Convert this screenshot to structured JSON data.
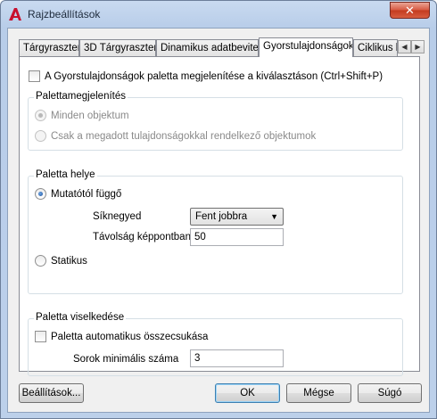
{
  "window": {
    "title": "Rajzbeállítások",
    "close_glyph": "✕",
    "app_icon": "autocad-a-icon"
  },
  "tabs": [
    {
      "label": "Tárgyraszter"
    },
    {
      "label": "3D Tárgyraszter"
    },
    {
      "label": "Dinamikus adatbevitel"
    },
    {
      "label": "Gyorstulajdonságok"
    },
    {
      "label": "Ciklikus k"
    }
  ],
  "active_tab": "Gyorstulajdonságok",
  "tab_scroll": {
    "left": "◀",
    "right": "▶"
  },
  "show_palette_checkbox": {
    "label": "A Gyorstulajdonságok paletta megjelenítése a kiválasztáson (Ctrl+Shift+P)",
    "checked": false
  },
  "palette_display": {
    "title": "Palettamegjelenítés",
    "options": [
      {
        "label": "Minden objektum",
        "selected": true,
        "enabled": false
      },
      {
        "label": "Csak a megadott tulajdonságokkal rendelkező objektumok",
        "selected": false,
        "enabled": false
      }
    ]
  },
  "palette_location": {
    "title": "Paletta helye",
    "cursor_option": {
      "label": "Mutatótól függő",
      "selected": true
    },
    "quadrant": {
      "label": "Síknegyed",
      "value": "Fent jobbra"
    },
    "distance": {
      "label": "Távolság képpontban",
      "value": "50"
    },
    "static_option": {
      "label": "Statikus",
      "selected": false
    }
  },
  "palette_behavior": {
    "title": "Paletta viselkedése",
    "autocollapse": {
      "label": "Paletta automatikus összecsukása",
      "checked": false
    },
    "min_rows": {
      "label": "Sorok minimális száma",
      "value": "3"
    }
  },
  "buttons": {
    "settings": "Beállítások...",
    "ok": "OK",
    "cancel": "Mégse",
    "help": "Súgó"
  },
  "colors": {
    "accent": "#3c7fb1",
    "close": "#c33a1f",
    "app_icon": "#c8102e"
  }
}
